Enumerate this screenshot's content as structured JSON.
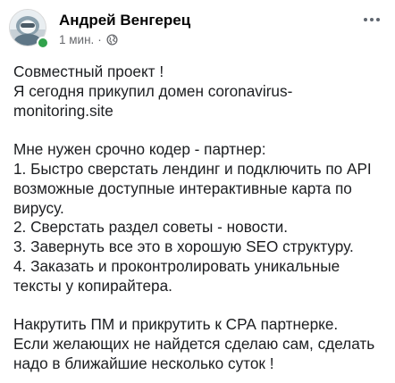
{
  "post": {
    "author": "Андрей Венгерец",
    "time": "1 мин.",
    "separator": "·",
    "privacy_icon": "globe-icon",
    "more_icon": "more-options-icon",
    "status_color": "#31a24c",
    "lines": [
      "Совместный проект !",
      "Я сегодня прикупил домен coronavirus-",
      "monitoring.site",
      "",
      "Мне нужен срочно кодер - партнер:",
      "1. Быстро сверстать лендинг и подключить по API",
      "возможные доступные интерактивные карта по",
      "вирусу.",
      "2. Сверстать раздел советы - новости.",
      "3. Завернуть все это в хорошую SEO структуру.",
      "4. Заказать и проконтролировать уникальные",
      "тексты у копирайтера.",
      "",
      "Накрутить ПМ и прикрутить к СРА партнерке.",
      "Если желающих не найдется сделаю сам, сделать",
      "надо в ближайшие несколько суток !"
    ]
  }
}
